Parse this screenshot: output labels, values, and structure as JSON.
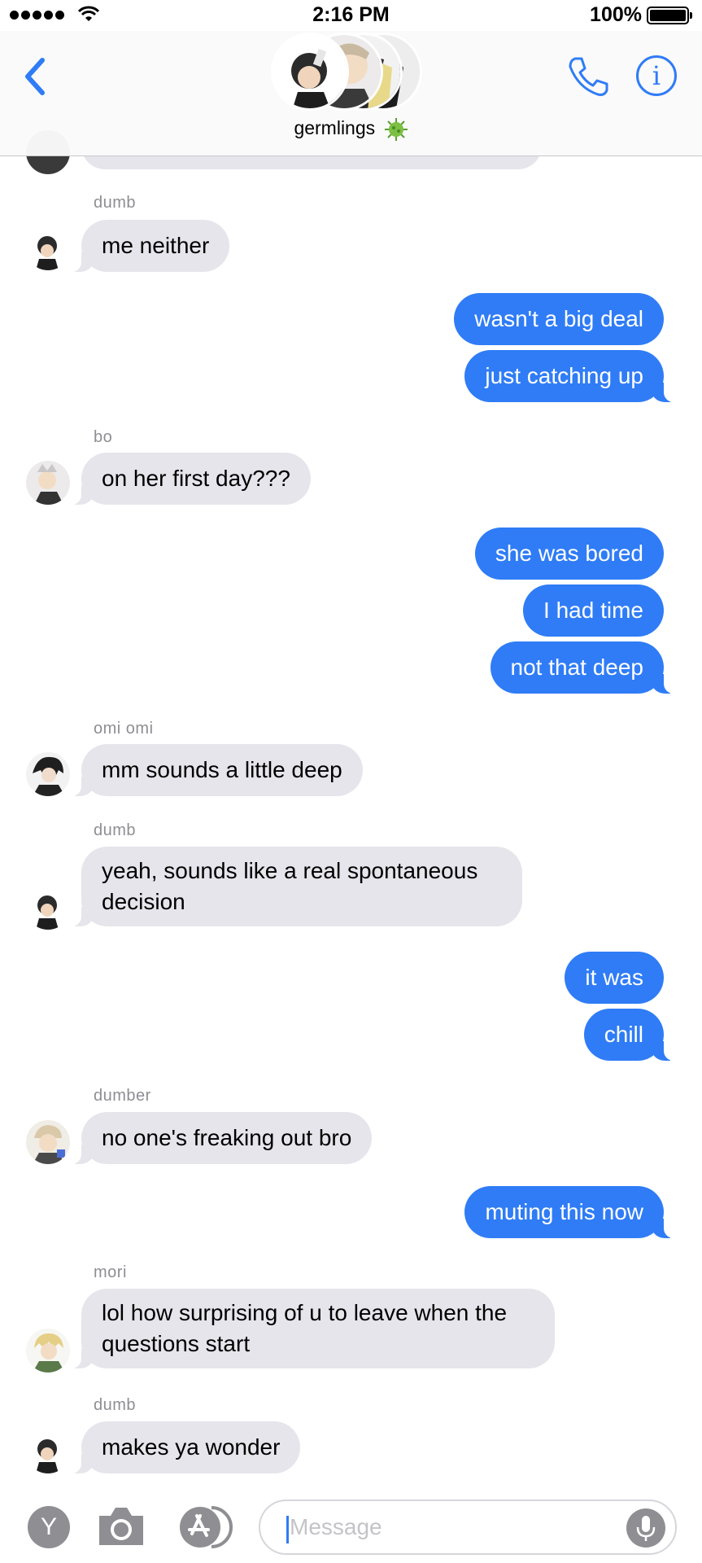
{
  "status_bar": {
    "time": "2:16 PM",
    "battery": "100%"
  },
  "header": {
    "group_name": "germlings",
    "group_emoji": "microbe-icon"
  },
  "colors": {
    "accent": "#2f7cf6",
    "incoming_bubble": "#e6e5eb",
    "sender_label": "#8e8e93"
  },
  "messages": [
    {
      "sender": "dumb",
      "text": "me neither"
    },
    {
      "text": "wasn't a big deal"
    },
    {
      "text": "just catching up"
    },
    {
      "sender": "bo",
      "text": "on her first day???"
    },
    {
      "text": "she was bored"
    },
    {
      "text": "I had time"
    },
    {
      "text": "not that deep"
    },
    {
      "sender": "omi omi",
      "text": "mm sounds a little deep"
    },
    {
      "sender": "dumb",
      "text": "yeah, sounds like a real spontaneous decision"
    },
    {
      "text": "it was"
    },
    {
      "text": "chill"
    },
    {
      "sender": "dumber",
      "text": "no one's freaking out bro"
    },
    {
      "text": "muting this now"
    },
    {
      "sender": "mori",
      "text": "lol how surprising of u to leave when the questions start"
    },
    {
      "sender": "dumb",
      "text": "makes ya wonder"
    }
  ],
  "input": {
    "app_letter": "Y",
    "placeholder": "Message"
  }
}
